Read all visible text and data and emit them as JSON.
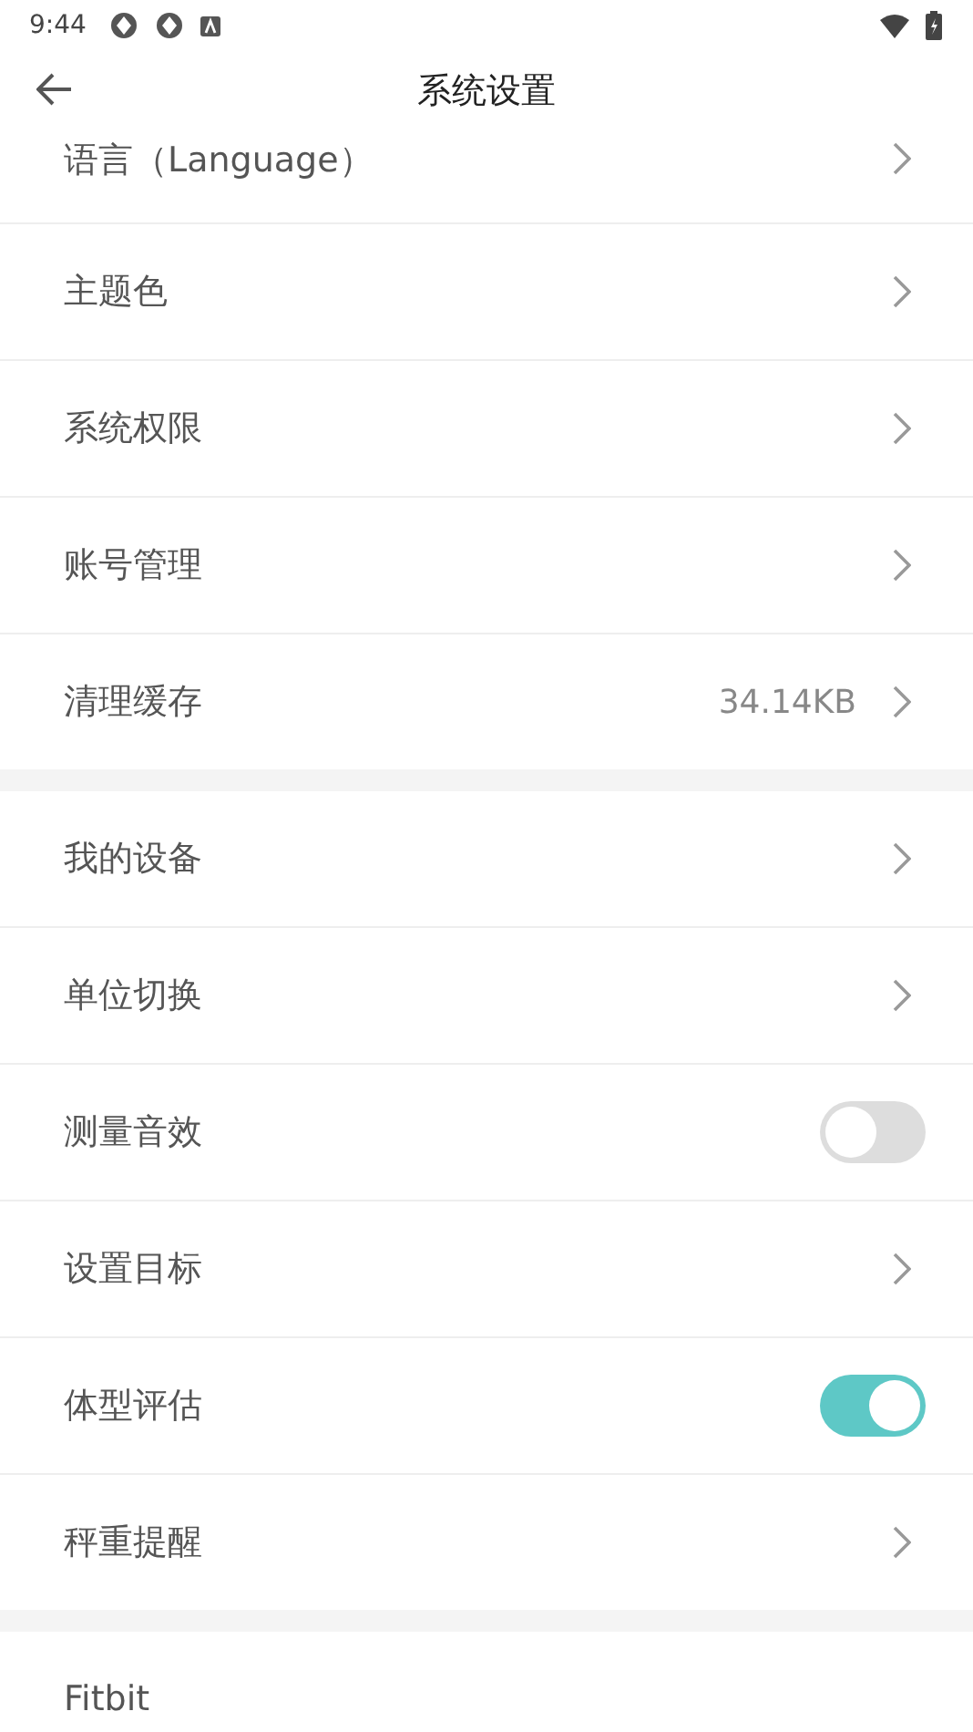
{
  "status_bar": {
    "time": "9:44"
  },
  "header": {
    "title": "系统设置"
  },
  "sections": [
    {
      "items": [
        {
          "kind": "link",
          "label": "语言（Language）"
        },
        {
          "kind": "link",
          "label": "主题色"
        },
        {
          "kind": "link",
          "label": "系统权限"
        },
        {
          "kind": "link",
          "label": "账号管理"
        },
        {
          "kind": "link",
          "label": "清理缓存",
          "value": "34.14KB"
        }
      ]
    },
    {
      "items": [
        {
          "kind": "link",
          "label": "我的设备"
        },
        {
          "kind": "link",
          "label": "单位切换"
        },
        {
          "kind": "toggle",
          "label": "测量音效",
          "on": false
        },
        {
          "kind": "link",
          "label": "设置目标"
        },
        {
          "kind": "toggle",
          "label": "体型评估",
          "on": true
        },
        {
          "kind": "link",
          "label": "秤重提醒"
        }
      ]
    },
    {
      "items": [
        {
          "kind": "plain",
          "label": "Fitbit"
        }
      ]
    }
  ]
}
